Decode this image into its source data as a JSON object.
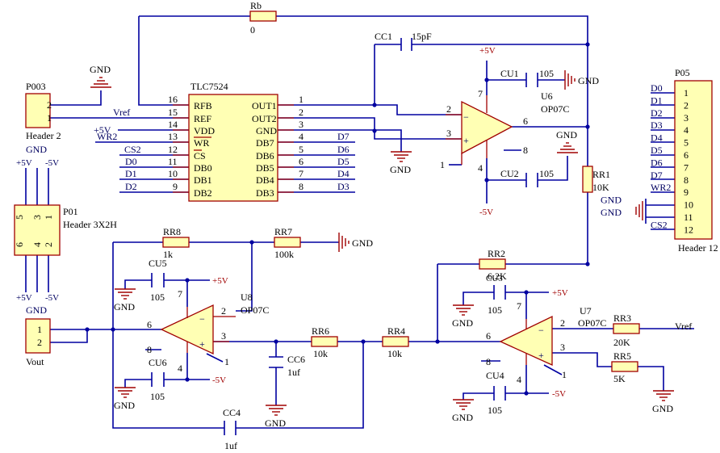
{
  "nets": {
    "gnd": "GND",
    "vref": "Vref",
    "p5v": "+5V",
    "m5v": "-5V"
  },
  "dac": {
    "name": "TLC7524",
    "left_pins": [
      {
        "num": "16",
        "name": "RFB"
      },
      {
        "num": "15",
        "name": "REF"
      },
      {
        "num": "14",
        "name": "VDD"
      },
      {
        "num": "13",
        "name": "WR"
      },
      {
        "num": "12",
        "name": "CS"
      },
      {
        "num": "11",
        "name": "DB0"
      },
      {
        "num": "10",
        "name": "DB1"
      },
      {
        "num": "9",
        "name": "DB2"
      }
    ],
    "right_pins": [
      {
        "num": "1",
        "name": "OUT1"
      },
      {
        "num": "2",
        "name": "OUT2"
      },
      {
        "num": "3",
        "name": "GND"
      },
      {
        "num": "4",
        "name": "DB7"
      },
      {
        "num": "5",
        "name": "DB6"
      },
      {
        "num": "6",
        "name": "DB5"
      },
      {
        "num": "7",
        "name": "DB4"
      },
      {
        "num": "8",
        "name": "DB3"
      }
    ],
    "left_nets": [
      "",
      "Vref",
      "+5V",
      "WR2",
      "CS2",
      "D0",
      "D1",
      "D2"
    ],
    "right_nets": [
      "",
      "",
      "",
      "D7",
      "D6",
      "D5",
      "D4",
      "D3"
    ]
  },
  "p003": {
    "ref": "P003",
    "name": "Header 2",
    "pins": [
      "2",
      "1"
    ]
  },
  "p01": {
    "ref": "P01",
    "name": "Header 3X2H",
    "pins_top": [
      "5",
      "3",
      "1"
    ],
    "pins_bot": [
      "6",
      "4",
      "2"
    ]
  },
  "vout": {
    "name": "Vout",
    "pins": [
      "1",
      "2"
    ]
  },
  "p05": {
    "ref": "P05",
    "name": "Header 12",
    "pins": [
      "1",
      "2",
      "3",
      "4",
      "5",
      "6",
      "7",
      "8",
      "9",
      "10",
      "11",
      "12"
    ],
    "nets": [
      "D0",
      "D1",
      "D2",
      "D3",
      "D4",
      "D5",
      "D6",
      "D7",
      "WR2",
      "GND",
      "GND",
      "CS2"
    ]
  },
  "parts": {
    "rb": {
      "ref": "Rb",
      "value": "0"
    },
    "cc1": {
      "ref": "CC1",
      "value": "15pF"
    },
    "cu1": {
      "ref": "CU1",
      "value": "105"
    },
    "cu2": {
      "ref": "CU2",
      "value": "105"
    },
    "u6": {
      "ref": "U6",
      "value": "OP07C"
    },
    "rr1": {
      "ref": "RR1",
      "value": "10K"
    },
    "rr8": {
      "ref": "RR8",
      "value": "1k"
    },
    "rr7": {
      "ref": "RR7",
      "value": "100k"
    },
    "cu5": {
      "ref": "CU5",
      "value": "105"
    },
    "cu6": {
      "ref": "CU6",
      "value": "105"
    },
    "u8": {
      "ref": "U8",
      "value": "OP07C"
    },
    "cc6": {
      "ref": "CC6",
      "value": "1uf"
    },
    "rr6": {
      "ref": "RR6",
      "value": "10k"
    },
    "rr4": {
      "ref": "RR4",
      "value": "10k"
    },
    "cc4": {
      "ref": "CC4",
      "value": "1uf"
    },
    "rr2": {
      "ref": "RR2",
      "value": "6.2K"
    },
    "cu3": {
      "ref": "CU3",
      "value": "105"
    },
    "u7": {
      "ref": "U7",
      "value": "OP07C"
    },
    "rr3": {
      "ref": "RR3",
      "value": "20K"
    },
    "rr5": {
      "ref": "RR5",
      "value": "5K"
    },
    "cu4": {
      "ref": "CU4",
      "value": "105"
    }
  },
  "opamp_pins": {
    "u6": [
      "2",
      "3",
      "6",
      "7",
      "4",
      "1",
      "8"
    ],
    "u8": [
      "2",
      "3",
      "6",
      "7",
      "4",
      "1",
      "8"
    ],
    "u7": [
      "2",
      "3",
      "6",
      "7",
      "4",
      "1",
      "8"
    ]
  }
}
